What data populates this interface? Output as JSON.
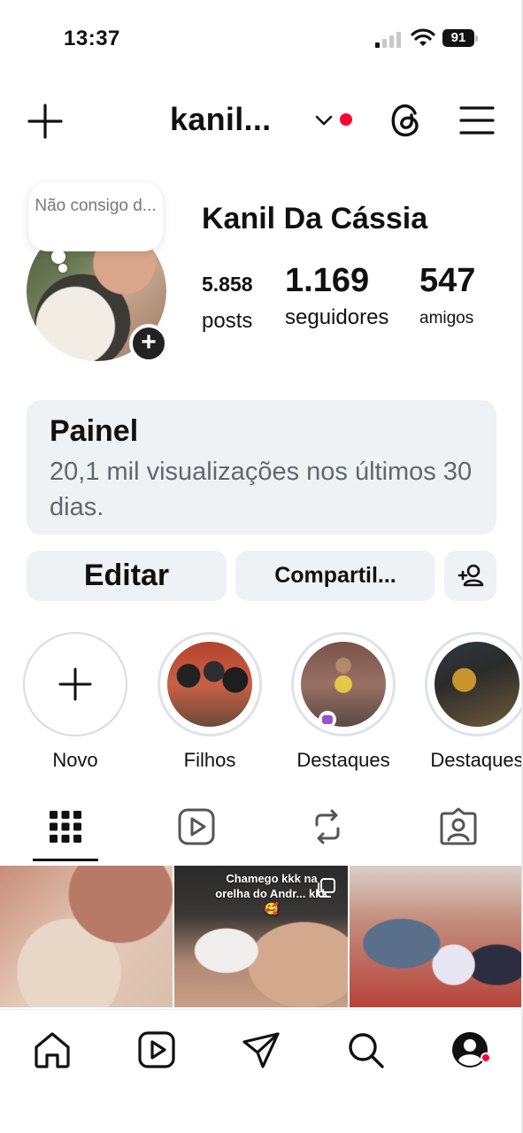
{
  "status_bar": {
    "time": "13:37",
    "battery": "91"
  },
  "header": {
    "username": "kanil..."
  },
  "profile": {
    "note": "Não consigo d...",
    "display_name": "Kanil Da Cássia",
    "stats": {
      "posts_count": "5.858",
      "posts_label": "posts",
      "followers_count": "1.169",
      "followers_label": "seguidores",
      "friends_count": "547",
      "friends_label": "amigos"
    }
  },
  "dashboard": {
    "title": "Painel",
    "subtitle": "20,1 mil visualizações nos últimos 30 dias."
  },
  "actions": {
    "edit": "Editar",
    "share": "Compartil..."
  },
  "highlights": [
    {
      "label": "Novo"
    },
    {
      "label": "Filhos"
    },
    {
      "label": "Destaques"
    },
    {
      "label": "Destaques"
    }
  ],
  "grid": {
    "post2_caption": "Chamego kkk na orelha do Andr... kkk🥰"
  },
  "colors": {
    "accent_red": "#ff0033",
    "card_bg": "#eff2f5",
    "secondary_text": "#606770"
  }
}
